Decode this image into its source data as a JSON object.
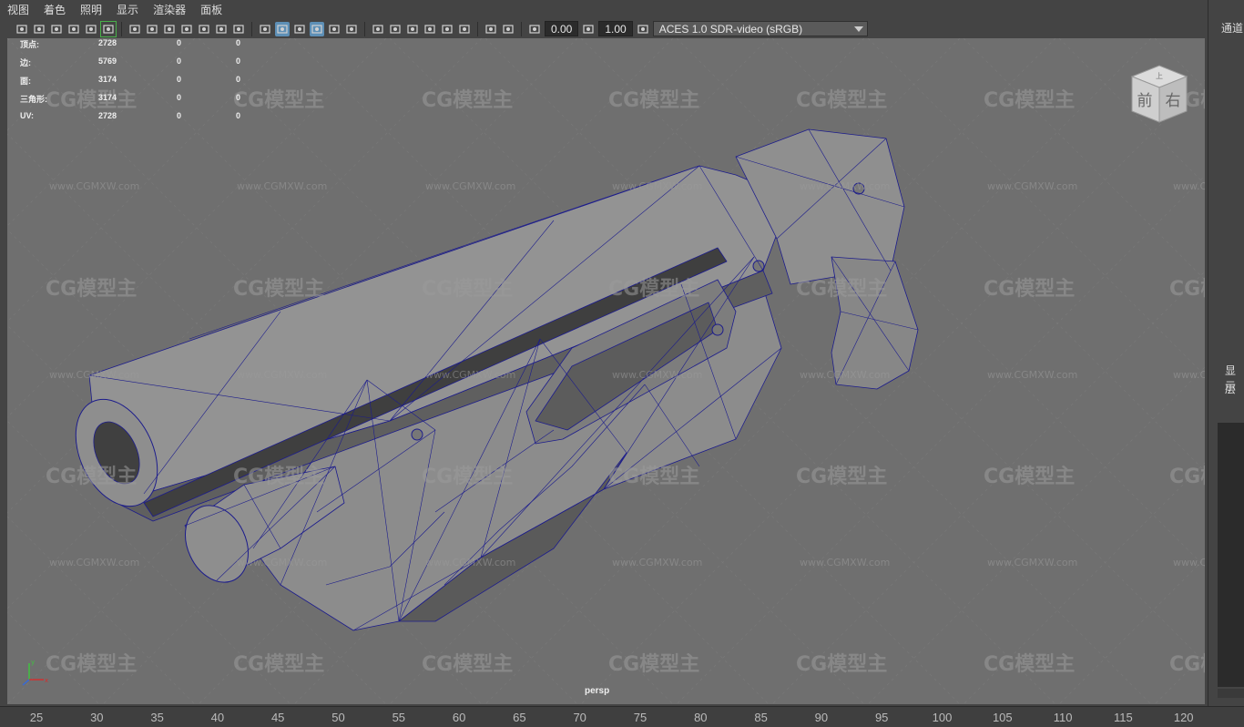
{
  "menu": [
    "视图",
    "着色",
    "照明",
    "显示",
    "渲染器",
    "面板"
  ],
  "toolbar": {
    "icons": [
      "camera-icon",
      "camera-attr-icon",
      "bookmark-icon",
      "image-plane-icon",
      "2d-pan-icon",
      "grease-pencil-icon",
      "grid-icon",
      "film-gate-icon",
      "resolution-gate-icon",
      "gate-mask-icon",
      "field-chart-icon",
      "safe-action-icon",
      "safe-title-icon",
      "wireframe-icon",
      "smooth-shade-icon",
      "flat-shade-icon",
      "wireframe-on-shaded-icon",
      "xray-icon",
      "default-light-icon",
      "shadow-icon",
      "ambient-occlusion-icon",
      "motion-blur-icon",
      "multisample-icon",
      "isolate-select-icon",
      "xray-joints-icon",
      "xray-active-icon",
      "backface-icon",
      "exposure-icon",
      "gamma-icon",
      "color-management-icon"
    ],
    "exposure": "0.00",
    "gamma": "1.00",
    "color_space": "ACES 1.0 SDR-video (sRGB)"
  },
  "hud": [
    {
      "label": "顶点:",
      "v1": "2728",
      "v2": "0",
      "v3": "0"
    },
    {
      "label": "边:",
      "v1": "5769",
      "v2": "0",
      "v3": "0"
    },
    {
      "label": "面:",
      "v1": "3174",
      "v2": "0",
      "v3": "0"
    },
    {
      "label": "三角形:",
      "v1": "3174",
      "v2": "0",
      "v3": "0"
    },
    {
      "label": "UV:",
      "v1": "2728",
      "v2": "0",
      "v3": "0"
    }
  ],
  "camera": "persp",
  "viewcube": {
    "front": "前",
    "right": "右",
    "top": "上"
  },
  "watermark": {
    "logo": "CG模型主",
    "url": "www.CGMXW.com"
  },
  "right_panel": {
    "channels": "通道",
    "display": "显示",
    "layer": "层"
  },
  "timeline": [
    "25",
    "30",
    "35",
    "40",
    "45",
    "50",
    "55",
    "60",
    "65",
    "70",
    "75",
    "80",
    "85",
    "90",
    "95",
    "100",
    "105",
    "110",
    "115",
    "120"
  ],
  "colors": {
    "viewport_bg": "#6f6f6f",
    "wire": "#1c1c8c",
    "surface": "#8a8a8a",
    "accent": "#5d8fb6"
  }
}
